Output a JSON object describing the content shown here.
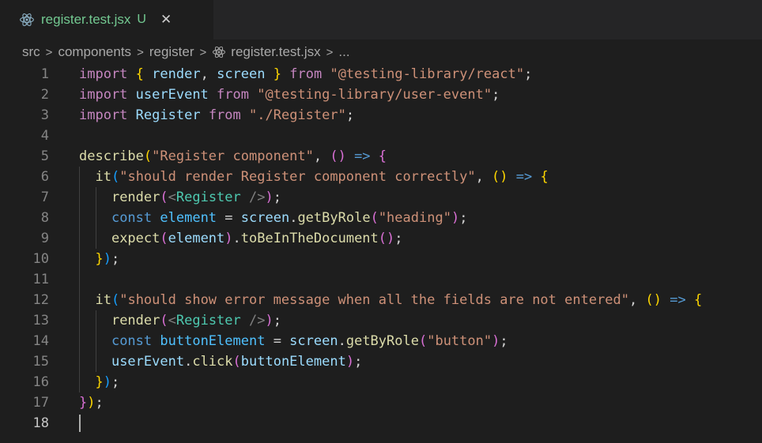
{
  "tab": {
    "title": "register.test.jsx",
    "status": "U",
    "close": "✕",
    "icon": "react-icon",
    "title_color": "#73c991"
  },
  "breadcrumb": {
    "items": [
      "src",
      "components",
      "register",
      "register.test.jsx",
      "..."
    ],
    "separator": ">"
  },
  "editor": {
    "active_line": 18,
    "line_numbers": [
      "1",
      "2",
      "3",
      "4",
      "5",
      "6",
      "7",
      "8",
      "9",
      "10",
      "11",
      "12",
      "13",
      "14",
      "15",
      "16",
      "17",
      "18"
    ],
    "lines": [
      [
        [
          "kw",
          "import"
        ],
        [
          "pn",
          " "
        ],
        [
          "br1",
          "{"
        ],
        [
          "pn",
          " "
        ],
        [
          "var",
          "render"
        ],
        [
          "pn",
          ", "
        ],
        [
          "var",
          "screen"
        ],
        [
          "pn",
          " "
        ],
        [
          "br1",
          "}"
        ],
        [
          "pn",
          " "
        ],
        [
          "kw",
          "from"
        ],
        [
          "pn",
          " "
        ],
        [
          "str",
          "\"@testing-library/react\""
        ],
        [
          "pn",
          ";"
        ]
      ],
      [
        [
          "kw",
          "import"
        ],
        [
          "pn",
          " "
        ],
        [
          "var",
          "userEvent"
        ],
        [
          "pn",
          " "
        ],
        [
          "kw",
          "from"
        ],
        [
          "pn",
          " "
        ],
        [
          "str",
          "\"@testing-library/user-event\""
        ],
        [
          "pn",
          ";"
        ]
      ],
      [
        [
          "kw",
          "import"
        ],
        [
          "pn",
          " "
        ],
        [
          "var",
          "Register"
        ],
        [
          "pn",
          " "
        ],
        [
          "kw",
          "from"
        ],
        [
          "pn",
          " "
        ],
        [
          "str",
          "\"./Register\""
        ],
        [
          "pn",
          ";"
        ]
      ],
      [],
      [
        [
          "fn",
          "describe"
        ],
        [
          "br1",
          "("
        ],
        [
          "str",
          "\"Register component\""
        ],
        [
          "pn",
          ", "
        ],
        [
          "br2",
          "()"
        ],
        [
          "pn",
          " "
        ],
        [
          "kw2",
          "=>"
        ],
        [
          "pn",
          " "
        ],
        [
          "br2",
          "{"
        ]
      ],
      [
        [
          "pn",
          "  "
        ],
        [
          "fn",
          "it"
        ],
        [
          "br3",
          "("
        ],
        [
          "str",
          "\"should render Register component correctly\""
        ],
        [
          "pn",
          ", "
        ],
        [
          "br1",
          "()"
        ],
        [
          "pn",
          " "
        ],
        [
          "kw2",
          "=>"
        ],
        [
          "pn",
          " "
        ],
        [
          "br1",
          "{"
        ]
      ],
      [
        [
          "pn",
          "    "
        ],
        [
          "fn",
          "render"
        ],
        [
          "br2",
          "("
        ],
        [
          "ang",
          "<"
        ],
        [
          "tag",
          "Register"
        ],
        [
          "pn",
          " "
        ],
        [
          "ang",
          "/>"
        ],
        [
          "br2",
          ")"
        ],
        [
          "pn",
          ";"
        ]
      ],
      [
        [
          "pn",
          "    "
        ],
        [
          "kw2",
          "const"
        ],
        [
          "pn",
          " "
        ],
        [
          "cn",
          "element"
        ],
        [
          "pn",
          " = "
        ],
        [
          "var",
          "screen"
        ],
        [
          "pn",
          "."
        ],
        [
          "fn",
          "getByRole"
        ],
        [
          "br2",
          "("
        ],
        [
          "str",
          "\"heading\""
        ],
        [
          "br2",
          ")"
        ],
        [
          "pn",
          ";"
        ]
      ],
      [
        [
          "pn",
          "    "
        ],
        [
          "fn",
          "expect"
        ],
        [
          "br2",
          "("
        ],
        [
          "var",
          "element"
        ],
        [
          "br2",
          ")"
        ],
        [
          "pn",
          "."
        ],
        [
          "fn",
          "toBeInTheDocument"
        ],
        [
          "br2",
          "()"
        ],
        [
          "pn",
          ";"
        ]
      ],
      [
        [
          "pn",
          "  "
        ],
        [
          "br1",
          "}"
        ],
        [
          "br3",
          ")"
        ],
        [
          "pn",
          ";"
        ]
      ],
      [],
      [
        [
          "pn",
          "  "
        ],
        [
          "fn",
          "it"
        ],
        [
          "br3",
          "("
        ],
        [
          "str",
          "\"should show error message when all the fields are not entered\""
        ],
        [
          "pn",
          ", "
        ],
        [
          "br1",
          "()"
        ],
        [
          "pn",
          " "
        ],
        [
          "kw2",
          "=>"
        ],
        [
          "pn",
          " "
        ],
        [
          "br1",
          "{"
        ]
      ],
      [
        [
          "pn",
          "    "
        ],
        [
          "fn",
          "render"
        ],
        [
          "br2",
          "("
        ],
        [
          "ang",
          "<"
        ],
        [
          "tag",
          "Register"
        ],
        [
          "pn",
          " "
        ],
        [
          "ang",
          "/>"
        ],
        [
          "br2",
          ")"
        ],
        [
          "pn",
          ";"
        ]
      ],
      [
        [
          "pn",
          "    "
        ],
        [
          "kw2",
          "const"
        ],
        [
          "pn",
          " "
        ],
        [
          "cn",
          "buttonElement"
        ],
        [
          "pn",
          " = "
        ],
        [
          "var",
          "screen"
        ],
        [
          "pn",
          "."
        ],
        [
          "fn",
          "getByRole"
        ],
        [
          "br2",
          "("
        ],
        [
          "str",
          "\"button\""
        ],
        [
          "br2",
          ")"
        ],
        [
          "pn",
          ";"
        ]
      ],
      [
        [
          "pn",
          "    "
        ],
        [
          "var",
          "userEvent"
        ],
        [
          "pn",
          "."
        ],
        [
          "fn",
          "click"
        ],
        [
          "br2",
          "("
        ],
        [
          "var",
          "buttonElement"
        ],
        [
          "br2",
          ")"
        ],
        [
          "pn",
          ";"
        ]
      ],
      [
        [
          "pn",
          "  "
        ],
        [
          "br1",
          "}"
        ],
        [
          "br3",
          ")"
        ],
        [
          "pn",
          ";"
        ]
      ],
      [
        [
          "br2",
          "}"
        ],
        [
          "br1",
          ")"
        ],
        [
          "pn",
          ";"
        ]
      ],
      []
    ]
  }
}
